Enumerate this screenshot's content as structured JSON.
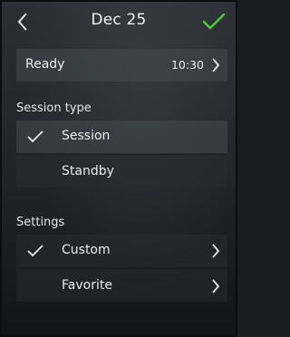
{
  "header": {
    "title": "Dec 25",
    "back_icon": "chevron-left-icon",
    "confirm_icon": "checkmark-icon",
    "confirm_color": "#4ecb3a"
  },
  "ready_row": {
    "label": "Ready",
    "time": "10:30"
  },
  "session_type": {
    "heading": "Session type",
    "options": [
      {
        "label": "Session",
        "selected": true
      },
      {
        "label": "Standby",
        "selected": false
      }
    ]
  },
  "settings": {
    "heading": "Settings",
    "options": [
      {
        "label": "Custom",
        "selected": true
      },
      {
        "label": "Favorite",
        "selected": false
      }
    ]
  }
}
